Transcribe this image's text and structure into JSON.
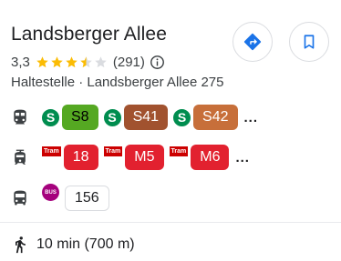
{
  "place": {
    "title": "Landsberger Allee",
    "rating": "3,3",
    "rating_value": 3.3,
    "rating_max": 5,
    "review_count": "(291)",
    "subtitle": "Haltestelle · Landsberger Allee 275"
  },
  "actions": {
    "directions_icon": "directions-icon",
    "save_icon": "bookmark-icon"
  },
  "lines": {
    "sbahn": {
      "mode_icon": "train-icon",
      "logo_text": "S",
      "items": [
        {
          "label": "S8",
          "color": "#55a822"
        },
        {
          "label": "S41",
          "color": "#a1522f"
        },
        {
          "label": "S42",
          "color": "#c76f3a"
        }
      ],
      "more": "..."
    },
    "tram": {
      "mode_icon": "tram-icon",
      "logo_text": "Tram",
      "items": [
        {
          "label": "18",
          "color": "#e2212f"
        },
        {
          "label": "M5",
          "color": "#e2212f"
        },
        {
          "label": "M6",
          "color": "#e2212f"
        }
      ],
      "more": "..."
    },
    "bus": {
      "mode_icon": "bus-icon",
      "logo_text": "BUS",
      "items": [
        {
          "label": "156",
          "color": "#ffffff"
        }
      ]
    }
  },
  "walk": {
    "icon": "walking-icon",
    "text": "10 min (700 m)"
  },
  "colors": {
    "star": "#fbbc04",
    "star_empty": "#dadce0",
    "accent": "#1a73e8",
    "sbahn": "#008d4f",
    "tram": "#cc0000",
    "bus": "#a5027d"
  }
}
